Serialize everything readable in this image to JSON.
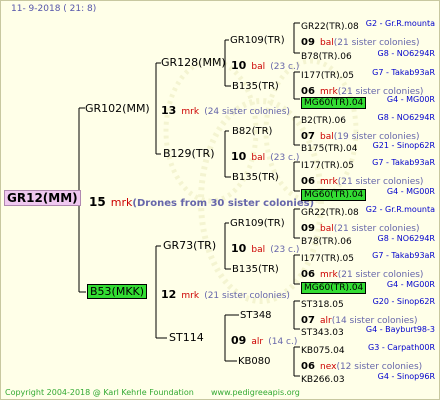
{
  "header": {
    "date_text": "11-  9-2018 ( 21:  8)"
  },
  "root": {
    "name": "GR12(MM)",
    "gen_num": "15",
    "gen_mark": "mrk",
    "note": "(Drones from 30 sister colonies)"
  },
  "gen1": [
    {
      "name": "GR102(MM)",
      "gen_num": "13",
      "gen_mark": "mrk",
      "note": "(24 sister colonies)"
    },
    {
      "name": "B53(MKK)",
      "gen_num": "12",
      "gen_mark": "mrk",
      "note": "(21 sister colonies)"
    }
  ],
  "gen2": [
    {
      "name": "GR128(MM)",
      "gen_num": "10",
      "gen_mark": "bal",
      "note": "(23 c.)"
    },
    {
      "name": "B129(TR)",
      "gen_num": "10",
      "gen_mark": "bal",
      "note": "(23 c.)"
    },
    {
      "name": "GR73(TR)",
      "gen_num": "10",
      "gen_mark": "bal",
      "note": "(23 c.)"
    },
    {
      "name": "ST114",
      "gen_num": "09",
      "gen_mark": "alr",
      "note": "(14 c.)"
    }
  ],
  "gen3": [
    {
      "name": "GR109(TR)"
    },
    {
      "name": "B135(TR)"
    },
    {
      "name": "B82(TR)"
    },
    {
      "name": "B135(TR)"
    },
    {
      "name": "GR109(TR)"
    },
    {
      "name": "B135(TR)"
    },
    {
      "name": "ST348"
    },
    {
      "name": "KB080"
    }
  ],
  "gen4": [
    {
      "name": "GR22(TR).08",
      "tag": "G2 - Gr.R.mounta"
    },
    {
      "num": "09",
      "mark": "bal",
      "note": "(21 sister colonies)"
    },
    {
      "name": "B78(TR).06",
      "tag": "G8 - NO6294R"
    },
    {
      "name": "I177(TR).05",
      "tag": "G7 - Takab93aR"
    },
    {
      "num": "06",
      "mark": "mrk",
      "note": "(21 sister colonies)"
    },
    {
      "name": "MG60(TR).04",
      "tag": "G4 - MG00R",
      "highlight": true
    },
    {
      "name": "B2(TR).06",
      "tag": "G8 - NO6294R"
    },
    {
      "num": "07",
      "mark": "bal",
      "note": "(19 sister colonies)"
    },
    {
      "name": "B175(TR).04",
      "tag": "G21 - Sinop62R"
    },
    {
      "name": "I177(TR).05",
      "tag": "G7 - Takab93aR"
    },
    {
      "num": "06",
      "mark": "mrk",
      "note": "(21 sister colonies)"
    },
    {
      "name": "MG60(TR).04",
      "tag": "G4 - MG00R",
      "highlight": true
    },
    {
      "name": "GR22(TR).08",
      "tag": "G2 - Gr.R.mounta"
    },
    {
      "num": "09",
      "mark": "bal",
      "note": "(21 sister colonies)"
    },
    {
      "name": "B78(TR).06",
      "tag": "G8 - NO6294R"
    },
    {
      "name": "I177(TR).05",
      "tag": "G7 - Takab93aR"
    },
    {
      "num": "06",
      "mark": "mrk",
      "note": "(21 sister colonies)"
    },
    {
      "name": "MG60(TR).04",
      "tag": "G4 - MG00R",
      "highlight": true
    },
    {
      "name": "ST318.05",
      "tag": "G20 - Sinop62R"
    },
    {
      "num": "07",
      "mark": "alr",
      "note": "(14 sister colonies)"
    },
    {
      "name": "ST343.03",
      "tag": "G4 - Bayburt98-3"
    },
    {
      "name": "KB075.04",
      "tag": "G3 - Carpath00R"
    },
    {
      "num": "06",
      "mark": "nex",
      "note": "(12 sister colonies)"
    },
    {
      "name": "KB266.03",
      "tag": "G4 - Sinop96R"
    }
  ],
  "footer": {
    "copyright": "Copyright 2004-2018 @ Karl Kehrle Foundation",
    "site": "www.pedigreeapis.org"
  }
}
